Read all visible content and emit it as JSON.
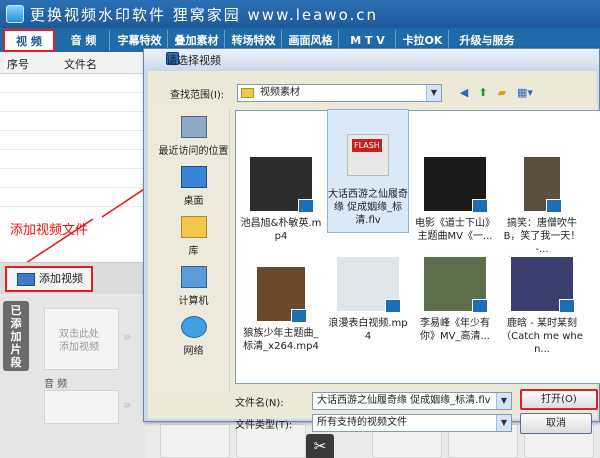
{
  "app": {
    "title": "更换视频水印软件  狸窝家园 www.leawo.cn"
  },
  "menu": {
    "tabs": [
      {
        "label": "视 频",
        "active": true
      },
      {
        "label": "音 频"
      },
      {
        "label": "字幕特效"
      },
      {
        "label": "叠加素材"
      },
      {
        "label": "转场特效"
      },
      {
        "label": "画面风格"
      },
      {
        "label": "M T V"
      },
      {
        "label": "卡拉OK"
      },
      {
        "label": "升级与服务"
      }
    ]
  },
  "list": {
    "columns": [
      "序号",
      "文件名"
    ]
  },
  "annotation": "添加视频文件",
  "add_button": "添加视频",
  "timeline": {
    "side_tab": "已添加片段",
    "placeholder": "双击此处\n添加视频",
    "audio_label": "音 频"
  },
  "dialog": {
    "title": "请选择视频",
    "lookin_label": "查找范围(I):",
    "lookin_value": "视频素材",
    "places": [
      "最近访问的位置",
      "桌面",
      "库",
      "计算机",
      "网络"
    ],
    "files": [
      {
        "name": "池昌旭&朴敏英.mp4",
        "thumb": "dark-scene"
      },
      {
        "name": "大话西游之仙履奇缘 促成姻缘_标清.flv",
        "thumb": "flash",
        "selected": true
      },
      {
        "name": "电影《道士下山》主题曲MV《一...",
        "thumb": "calligraphy"
      },
      {
        "name": "搞笑：唐僧吹牛B，笑了我一天！-...",
        "thumb": "people"
      },
      {
        "name": "狼族少年主题曲_标清_x264.mp4",
        "thumb": "person"
      },
      {
        "name": "浪漫表白视频.mp4",
        "thumb": "light"
      },
      {
        "name": "李易峰《年少有你》MV_高清...",
        "thumb": "landscape"
      },
      {
        "name": "鹿晗 - 某时某刻（Catch me when...",
        "thumb": "concert"
      }
    ],
    "filename_label": "文件名(N):",
    "filename_value": "大话西游之仙履奇缘 促成姻缘_标清.flv",
    "filetype_label": "文件类型(T):",
    "filetype_value": "所有支持的视频文件",
    "open_button": "打开(O)",
    "cancel_button": "取消"
  },
  "colors": {
    "title_bar": "#1d5a9a",
    "highlight": "#e02020",
    "selection": "#dbe8f8"
  }
}
